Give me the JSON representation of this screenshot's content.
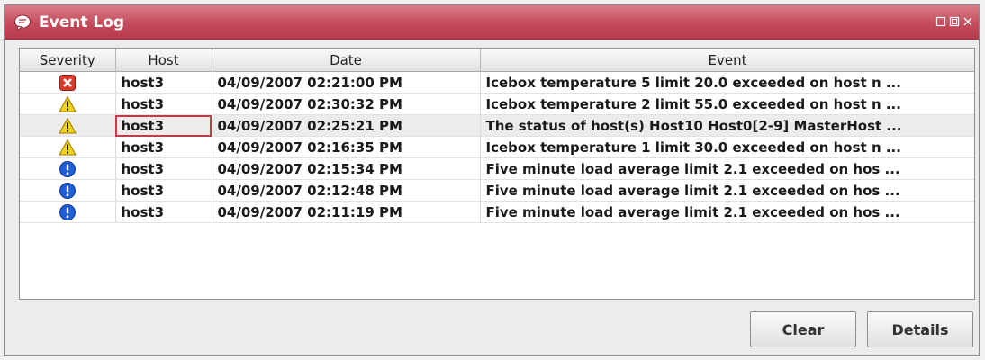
{
  "window": {
    "title": "Event Log",
    "controls": [
      "restore-icon",
      "maximize-icon",
      "close-icon"
    ]
  },
  "table": {
    "columns": [
      "Severity",
      "Host",
      "Date",
      "Event"
    ],
    "rows": [
      {
        "severity": "error",
        "icon": "error-icon",
        "host": "host3",
        "date": "04/09/2007 02:21:00 PM",
        "event": "Icebox temperature 5 limit 20.0 exceeded on host n ..."
      },
      {
        "severity": "warning",
        "icon": "warning-icon",
        "host": "host3",
        "date": "04/09/2007 02:30:32 PM",
        "event": "Icebox temperature 2 limit 55.0 exceeded on host n ..."
      },
      {
        "severity": "warning",
        "icon": "warning-icon",
        "host": "host3",
        "date": "04/09/2007 02:25:21 PM",
        "event": "The status of host(s) Host10 Host0[2-9] MasterHost ..."
      },
      {
        "severity": "warning",
        "icon": "warning-icon",
        "host": "host3",
        "date": "04/09/2007 02:16:35 PM",
        "event": "Icebox temperature 1 limit 30.0 exceeded on host n ..."
      },
      {
        "severity": "info",
        "icon": "info-icon",
        "host": "host3",
        "date": "04/09/2007 02:15:34 PM",
        "event": "Five minute load average limit 2.1 exceeded on hos ..."
      },
      {
        "severity": "info",
        "icon": "info-icon",
        "host": "host3",
        "date": "04/09/2007 02:12:48 PM",
        "event": "Five minute load average limit 2.1 exceeded on hos ..."
      },
      {
        "severity": "info",
        "icon": "info-icon",
        "host": "host3",
        "date": "04/09/2007 02:11:19 PM",
        "event": "Five minute load average limit 2.1 exceeded on hos ..."
      }
    ],
    "selected_row": 2,
    "focused_cell": "host"
  },
  "buttons": {
    "clear": "Clear",
    "details": "Details"
  },
  "colors": {
    "titlebar": "#c44c5c",
    "error": "#d83a2a",
    "warning": "#f2d21a",
    "info": "#1f5fd6",
    "focus": "#c33a48"
  }
}
